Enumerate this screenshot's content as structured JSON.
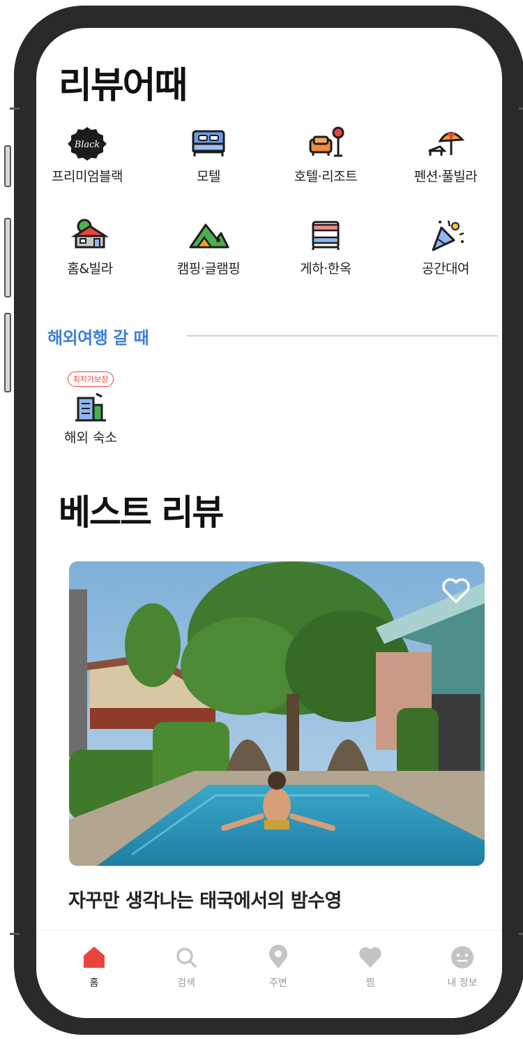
{
  "app": {
    "title": "리뷰어때"
  },
  "categories": [
    {
      "label": "프리미엄블랙",
      "icon": "black-badge-icon"
    },
    {
      "label": "모텔",
      "icon": "bed-icon"
    },
    {
      "label": "호텔·리조트",
      "icon": "sofa-lamp-icon"
    },
    {
      "label": "펜션·풀빌라",
      "icon": "beach-umbrella-icon"
    },
    {
      "label": "홈&빌라",
      "icon": "house-icon"
    },
    {
      "label": "캠핑·글램핑",
      "icon": "mountain-tent-icon"
    },
    {
      "label": "게하·한옥",
      "icon": "bunk-bed-icon"
    },
    {
      "label": "공간대여",
      "icon": "party-popper-icon"
    }
  ],
  "black_badge_text": "Black",
  "overseas_section": {
    "title": "해외여행 갈 때",
    "item": {
      "badge": "최저가보장",
      "label": "해외 숙소",
      "icon": "building-icon"
    }
  },
  "best_reviews": {
    "title": "베스트 리뷰",
    "card": {
      "caption": "자꾸만 생각나는 태국에서의 밤수영",
      "liked": false,
      "icon": "heart-outline-icon"
    }
  },
  "tabbar": {
    "items": [
      {
        "label": "홈",
        "icon": "home-icon",
        "active": true
      },
      {
        "label": "검색",
        "icon": "search-icon",
        "active": false
      },
      {
        "label": "주변",
        "icon": "location-pin-icon",
        "active": false
      },
      {
        "label": "찜",
        "icon": "heart-icon",
        "active": false
      },
      {
        "label": "내 정보",
        "icon": "profile-face-icon",
        "active": false
      }
    ]
  },
  "colors": {
    "accent_blue": "#3b7ee0",
    "badge_red": "#e8453c",
    "active_tab": "#e8453c",
    "inactive_tab": "#c4c4c4",
    "frame": "#2a2a2a"
  }
}
